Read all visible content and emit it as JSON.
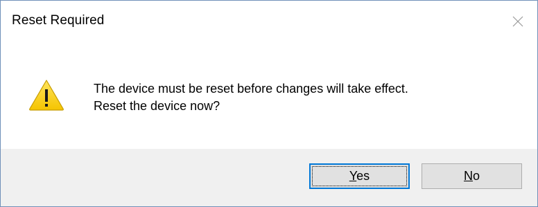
{
  "dialog": {
    "title": "Reset Required",
    "close_icon": "close-icon",
    "icon": "warning-icon",
    "message_line1": "The device must be reset before changes will take effect.",
    "message_line2": "Reset the device now?"
  },
  "buttons": {
    "yes": {
      "label_first": "Y",
      "label_rest": "es",
      "default": true
    },
    "no": {
      "label_first": "N",
      "label_rest": "o",
      "default": false
    }
  },
  "colors": {
    "accent": "#0078d7",
    "warning_fill": "#fcd116",
    "footer_bg": "#f0f0f0",
    "border": "#6f90b9"
  }
}
